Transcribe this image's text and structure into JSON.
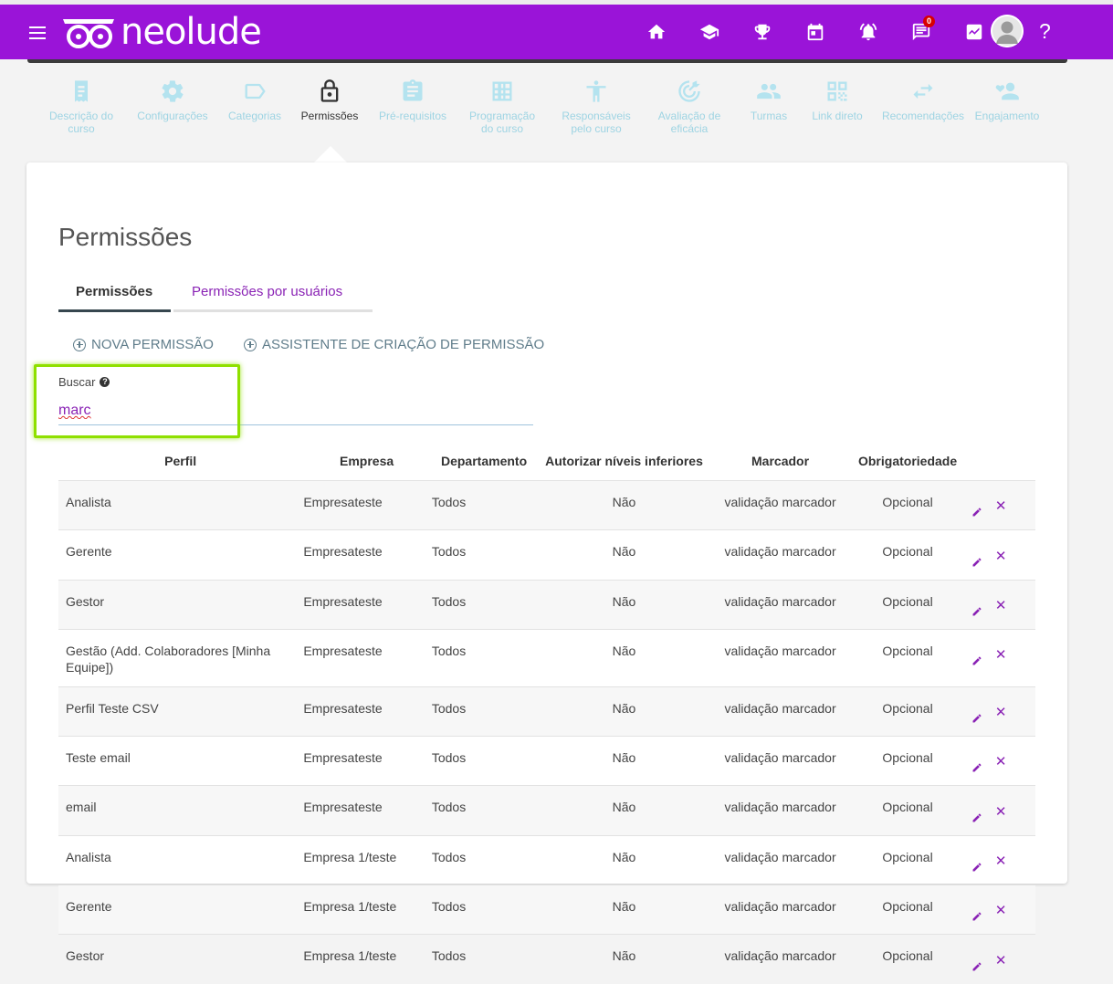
{
  "header": {
    "logo_text": "neolude",
    "notification_count": "0",
    "help_label": "?",
    "nav_icons": [
      "home-icon",
      "graduation-cap-icon",
      "trophy-icon",
      "calendar-icon",
      "bell-icon",
      "chat-icon",
      "chart-icon"
    ]
  },
  "steps": [
    {
      "label": "Descrição do curso",
      "icon": "document-icon",
      "active": false
    },
    {
      "label": "Configurações",
      "icon": "gear-icon",
      "active": false
    },
    {
      "label": "Categorias",
      "icon": "tag-icon",
      "active": false
    },
    {
      "label": "Permissões",
      "icon": "lock-icon",
      "active": true
    },
    {
      "label": "Pré-requisitos",
      "icon": "clipboard-icon",
      "active": false
    },
    {
      "label": "Programação do curso",
      "icon": "grid-icon",
      "active": false
    },
    {
      "label": "Responsáveis pelo curso",
      "icon": "person-icon",
      "active": false
    },
    {
      "label": "Avaliação de eficácia",
      "icon": "target-icon",
      "active": false
    },
    {
      "label": "Turmas",
      "icon": "group-icon",
      "active": false
    },
    {
      "label": "Link direto",
      "icon": "qr-icon",
      "active": false
    },
    {
      "label": "Recomendações",
      "icon": "arrows-icon",
      "active": false
    },
    {
      "label": "Engajamento",
      "icon": "user-heart-icon",
      "active": false
    }
  ],
  "page": {
    "title": "Permissões",
    "tabs": [
      "Permissões",
      "Permissões por usuários"
    ],
    "actions": [
      "NOVA PERMISSÃO",
      "ASSISTENTE DE CRIAÇÃO DE PERMISSÃO"
    ],
    "search_label": "Buscar",
    "search_value": "marc"
  },
  "table": {
    "columns": [
      "Perfil",
      "Empresa",
      "Departamento",
      "Autorizar níveis inferiores",
      "Marcador",
      "Obrigatoriedade"
    ],
    "rows": [
      [
        "Analista",
        "Empresateste",
        "Todos",
        "Não",
        "validação marcador",
        "Opcional"
      ],
      [
        "Gerente",
        "Empresateste",
        "Todos",
        "Não",
        "validação marcador",
        "Opcional"
      ],
      [
        "Gestor",
        "Empresateste",
        "Todos",
        "Não",
        "validação marcador",
        "Opcional"
      ],
      [
        "Gestão (Add. Colaboradores [Minha Equipe])",
        "Empresateste",
        "Todos",
        "Não",
        "validação marcador",
        "Opcional"
      ],
      [
        "Perfil Teste CSV",
        "Empresateste",
        "Todos",
        "Não",
        "validação marcador",
        "Opcional"
      ],
      [
        "Teste email",
        "Empresateste",
        "Todos",
        "Não",
        "validação marcador",
        "Opcional"
      ],
      [
        "email",
        "Empresateste",
        "Todos",
        "Não",
        "validação marcador",
        "Opcional"
      ],
      [
        "Analista",
        "Empresa 1/teste",
        "Todos",
        "Não",
        "validação marcador",
        "Opcional"
      ],
      [
        "Gerente",
        "Empresa 1/teste",
        "Todos",
        "Não",
        "validação marcador",
        "Opcional"
      ],
      [
        "Gestor",
        "Empresa 1/teste",
        "Todos",
        "Não",
        "validação marcador",
        "Opcional"
      ]
    ],
    "delete_glyph": "✕"
  },
  "colors": {
    "brand": "#9a14d8",
    "accent": "#8a23b5",
    "step_inactive": "#b4e3ef",
    "highlight": "#8fe000"
  }
}
